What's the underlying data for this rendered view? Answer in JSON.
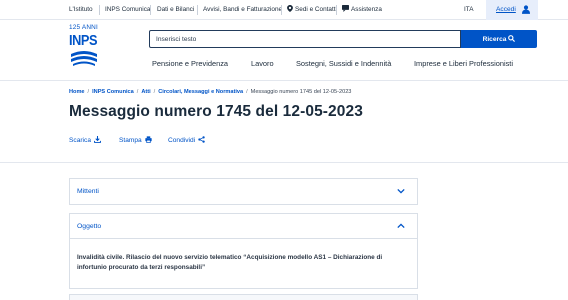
{
  "topbar": {
    "links": [
      "L'Istituto",
      "INPS Comunica",
      "Dati e Bilanci",
      "Avvisi, Bandi e Fatturazione",
      "Sedi e Contatti",
      "Assistenza"
    ],
    "lang": "ITA",
    "login": "Accedi"
  },
  "logo": {
    "anni": "125 ANNI",
    "word": "INPS"
  },
  "search": {
    "placeholder": "Inserisci testo",
    "button": "Ricerca"
  },
  "nav": [
    "Pensione e Previdenza",
    "Lavoro",
    "Sostegni, Sussidi e Indennità",
    "Imprese e Liberi Professionisti"
  ],
  "breadcrumb": [
    "Home",
    "INPS Comunica",
    "Atti",
    "Circolari, Messaggi e Normativa",
    "Messaggio numero 1745 del 12-05-2023"
  ],
  "title": "Messaggio numero 1745 del 12-05-2023",
  "actions": {
    "download": "Scarica",
    "print": "Stampa",
    "share": "Condividi"
  },
  "accordions": {
    "mittenti": {
      "title": "Mittenti"
    },
    "oggetto": {
      "title": "Oggetto",
      "body": "Invalidità civile. Rilascio del nuovo servizio telematico “Acquisizione modello AS1 – Dichiarazione di infortunio procurato da terzi responsabili”"
    }
  },
  "colors": {
    "brand": "#0054c7",
    "text": "#1b2a3a",
    "login_bg": "#e7eefb"
  }
}
